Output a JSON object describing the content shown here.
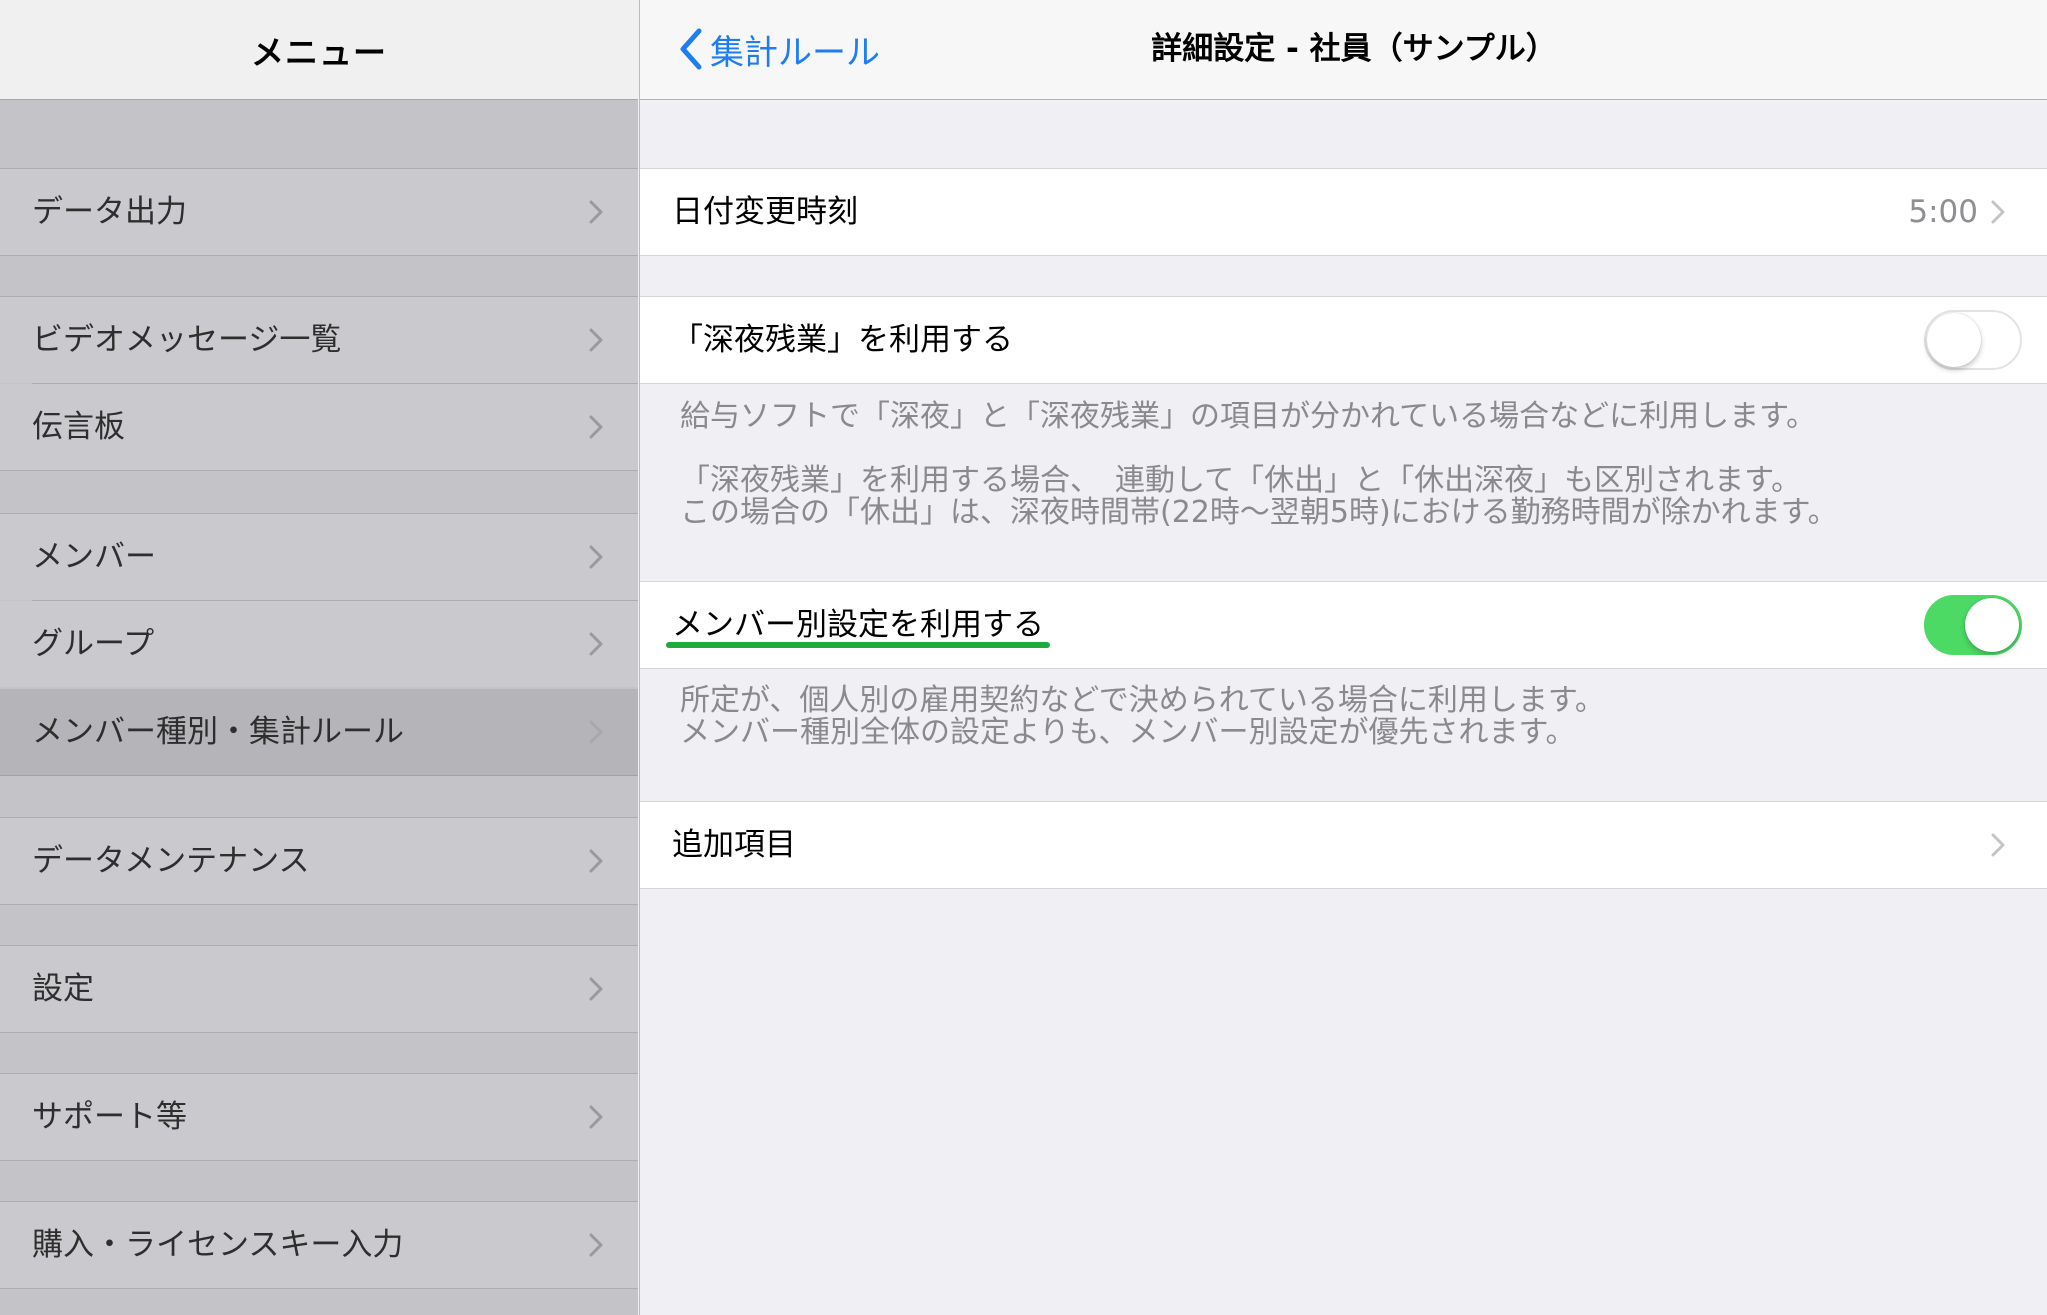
{
  "sidebar": {
    "title": "メニュー",
    "items": [
      {
        "label": "データ出力"
      },
      {
        "label": "ビデオメッセージ一覧"
      },
      {
        "label": "伝言板"
      },
      {
        "label": "メンバー"
      },
      {
        "label": "グループ"
      },
      {
        "label": "メンバー種別・集計ルール",
        "selected": true
      },
      {
        "label": "データメンテナンス"
      },
      {
        "label": "設定"
      },
      {
        "label": "サポート等"
      },
      {
        "label": "購入・ライセンスキー入力"
      }
    ],
    "chevron_icon": "chevron-right-icon"
  },
  "detail": {
    "back_label": "集計ルール",
    "back_icon": "chevron-left-icon",
    "title": "詳細設定 - 社員（サンプル）",
    "date_change": {
      "label": "日付変更時刻",
      "value": "5:00"
    },
    "late_night_overtime": {
      "label": "「深夜残業」を利用する",
      "enabled": false,
      "footer_line1": "給与ソフトで「深夜」と「深夜残業」の項目が分かれている場合などに利用します。",
      "footer_line2": "「深夜残業」を利用する場合、　連動して「休出」と「休出深夜」も区別されます。",
      "footer_line3": "この場合の「休出」は、深夜時間帯(22時〜翌朝5時)における勤務時間が除かれます。"
    },
    "member_settings": {
      "label": "メンバー別設定を利用する",
      "enabled": true,
      "footer_line1": "所定が、個人別の雇用契約などで決められている場合に利用します。",
      "footer_line2": "メンバー種別全体の設定よりも、メンバー別設定が優先されます。"
    },
    "additional_items": {
      "label": "追加項目"
    }
  },
  "colors": {
    "accent": "#1e7ef0",
    "toggle_on": "#4cd964",
    "highlight_underline": "#1faa3f"
  }
}
